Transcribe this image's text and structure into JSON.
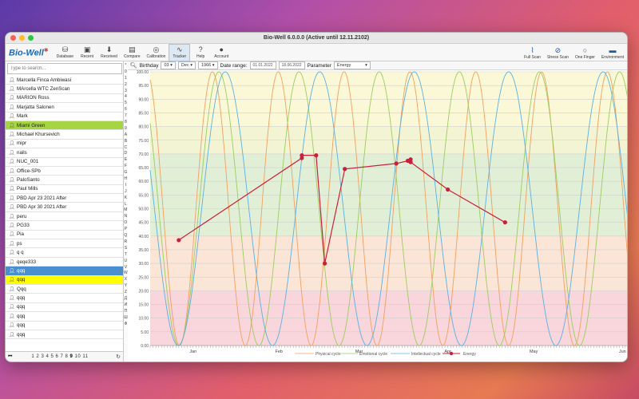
{
  "window": {
    "title": "Bio-Well 6.0.0.0 (Active until 12.11.2102)"
  },
  "toolbar": {
    "logo": "Bio-Well",
    "buttons": [
      {
        "label": "Database",
        "icon": "database-icon",
        "glyph": "⛁"
      },
      {
        "label": "Recent",
        "icon": "recent-icon",
        "glyph": "▣"
      },
      {
        "label": "Received",
        "icon": "received-icon",
        "glyph": "⬇"
      },
      {
        "label": "Compare",
        "icon": "compare-icon",
        "glyph": "▤"
      },
      {
        "label": "Calibration",
        "icon": "calibration-icon",
        "glyph": "◎"
      },
      {
        "label": "Tracker",
        "icon": "tracker-icon",
        "glyph": "∿"
      },
      {
        "label": "Help",
        "icon": "help-icon",
        "glyph": "?"
      },
      {
        "label": "Account",
        "icon": "account-icon",
        "glyph": "●"
      }
    ],
    "right_buttons": [
      {
        "label": "Full Scan",
        "icon": "paperclip-icon",
        "glyph": "⌇"
      },
      {
        "label": "Stress Scan",
        "icon": "stress-scan-icon",
        "glyph": "⊘"
      },
      {
        "label": "One Finger",
        "icon": "one-finger-icon",
        "glyph": "○"
      },
      {
        "label": "Environment",
        "icon": "environment-icon",
        "glyph": "▬"
      }
    ]
  },
  "sidebar": {
    "search_placeholder": "Type to search...",
    "items": [
      {
        "name": "Marcella Finca Ambiwasi",
        "state": ""
      },
      {
        "name": "MArcella WTC ZenScan",
        "state": ""
      },
      {
        "name": "MARION Ross",
        "state": ""
      },
      {
        "name": "Marjatta Salonen",
        "state": ""
      },
      {
        "name": "Mark",
        "state": ""
      },
      {
        "name": "Miami Green",
        "state": "green"
      },
      {
        "name": "Michael Khursevich",
        "state": ""
      },
      {
        "name": "mipr",
        "state": ""
      },
      {
        "name": "nails",
        "state": ""
      },
      {
        "name": "NUC_001",
        "state": ""
      },
      {
        "name": "Office-SPb",
        "state": ""
      },
      {
        "name": "PaloSanto",
        "state": ""
      },
      {
        "name": "Paul Mills",
        "state": ""
      },
      {
        "name": "PBD Apr 23 2021 After",
        "state": ""
      },
      {
        "name": "PBD Apr 30 2021 After",
        "state": ""
      },
      {
        "name": "peru",
        "state": ""
      },
      {
        "name": "PG33",
        "state": ""
      },
      {
        "name": "Pia",
        "state": ""
      },
      {
        "name": "ps",
        "state": ""
      },
      {
        "name": "q q",
        "state": ""
      },
      {
        "name": "qeqe333",
        "state": ""
      },
      {
        "name": "qqq",
        "state": "blue"
      },
      {
        "name": "qqq",
        "state": "yellow"
      },
      {
        "name": "Qqq",
        "state": ""
      },
      {
        "name": "qqq",
        "state": ""
      },
      {
        "name": "qqq",
        "state": ""
      },
      {
        "name": "qqq",
        "state": ""
      },
      {
        "name": "qqq",
        "state": ""
      },
      {
        "name": "qqq",
        "state": ""
      }
    ],
    "pager": {
      "pages": [
        "1",
        "2",
        "3",
        "4",
        "5",
        "6",
        "7",
        "8",
        "9",
        "10",
        "11"
      ],
      "current": "9"
    },
    "alphabet": [
      "*",
      "0",
      "1",
      "2",
      "3",
      "4",
      "5",
      "6",
      "7",
      "8",
      "9",
      "A",
      "B",
      "C",
      "D",
      "E",
      "F",
      "G",
      "H",
      "I",
      "J",
      "K",
      "L",
      "M",
      "N",
      "O",
      "P",
      "Q",
      "R",
      "S",
      "T",
      "U",
      "V",
      "W",
      "X",
      "Y",
      "Z",
      "Д",
      "И",
      "П",
      "Ш",
      "Ф"
    ]
  },
  "controls": {
    "birthday_label": "Birthday",
    "birth_day": "03",
    "birth_month": "Dec",
    "birth_year": "1966",
    "date_range_label": "Date range:",
    "date_from": "01.01.2022",
    "date_to": "18.06.2022",
    "parameter_label": "Parameter",
    "parameter_value": "Energy"
  },
  "chart_data": {
    "type": "line",
    "ylim": [
      0,
      100
    ],
    "y_ticks": [
      "0.00",
      "5.00",
      "10.00",
      "15.00",
      "20.00",
      "25.00",
      "30.00",
      "35.00",
      "40.00",
      "45.00",
      "50.00",
      "55.00",
      "60.00",
      "65.00",
      "70.00",
      "75.00",
      "80.00",
      "85.00",
      "90.00",
      "95.00",
      "100.00"
    ],
    "x_domain": [
      "2022-01-01",
      "2022-06-18"
    ],
    "x_labels": [
      {
        "label": "Jan",
        "date": "2022-01-16"
      },
      {
        "label": "Feb",
        "date": "2022-02-15"
      },
      {
        "label": "Mar",
        "date": "2022-03-15"
      },
      {
        "label": "Apr",
        "date": "2022-04-15"
      },
      {
        "label": "May",
        "date": "2022-05-15"
      },
      {
        "label": "Jun",
        "date": "2022-06-15"
      }
    ],
    "bands": [
      {
        "from": 80,
        "to": 100,
        "color": "#fbf8d8"
      },
      {
        "from": 70,
        "to": 80,
        "color": "#f3f4d4"
      },
      {
        "from": 40,
        "to": 70,
        "color": "#e2efd7"
      },
      {
        "from": 20,
        "to": 40,
        "color": "#fbe5d6"
      },
      {
        "from": 0,
        "to": 20,
        "color": "#f9d6db"
      }
    ],
    "cycles": [
      {
        "name": "Physical cycle",
        "color": "#f0a060",
        "period": 23,
        "phase_date": "2021-12-25"
      },
      {
        "name": "Emotional cycle",
        "color": "#9ccc60",
        "period": 28,
        "phase_date": "2021-12-21"
      },
      {
        "name": "Intellectual cycle",
        "color": "#5ab0e0",
        "period": 33,
        "phase_date": "2021-12-17"
      }
    ],
    "series": [
      {
        "name": "Energy",
        "color": "#c8203c",
        "points": [
          {
            "x": "2022-01-11",
            "y": 38.5
          },
          {
            "x": "2022-02-23",
            "y": 68.5
          },
          {
            "x": "2022-02-23",
            "y": 69.5
          },
          {
            "x": "2022-02-28",
            "y": 69.5
          },
          {
            "x": "2022-03-03",
            "y": 30.0
          },
          {
            "x": "2022-03-10",
            "y": 64.5
          },
          {
            "x": "2022-03-28",
            "y": 66.5
          },
          {
            "x": "2022-04-01",
            "y": 67.5
          },
          {
            "x": "2022-04-02",
            "y": 68.0
          },
          {
            "x": "2022-04-02",
            "y": 67.0
          },
          {
            "x": "2022-04-15",
            "y": 57.0
          },
          {
            "x": "2022-05-05",
            "y": 45.0
          }
        ]
      }
    ],
    "legend": [
      "Physical cycle",
      "Emotional cycle",
      "Intellectual cycle",
      "Energy"
    ]
  }
}
